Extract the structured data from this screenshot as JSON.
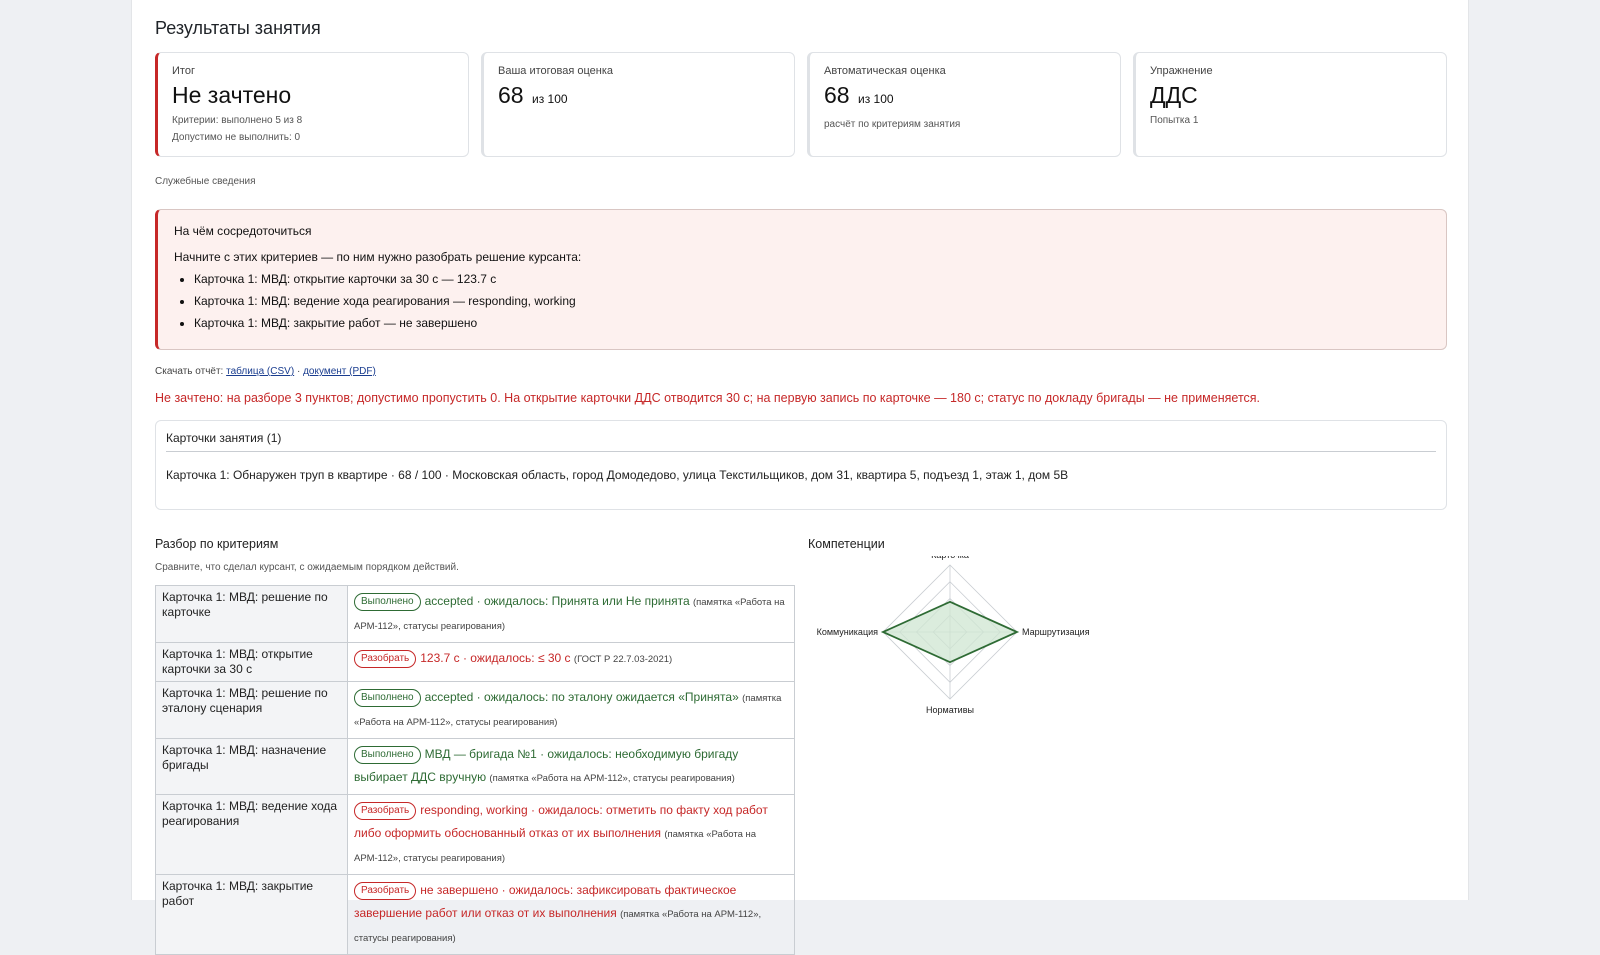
{
  "page_title": "Результаты занятия",
  "summary": {
    "result": {
      "label": "Итог",
      "value": "Не зачтено",
      "criteria": "Критерии: выполнено 5 из 8",
      "allowed": "Допустимо не выполнить: 0"
    },
    "final_score": {
      "label": "Ваша итоговая оценка",
      "value": "68",
      "of": "из 100"
    },
    "auto_score": {
      "label": "Автоматическая оценка",
      "value": "68",
      "of": "из 100",
      "note": "расчёт по критериям занятия"
    },
    "exercise": {
      "label": "Упражнение",
      "value": "ДДС",
      "attempt": "Попытка 1"
    }
  },
  "service_info": "Служебные сведения",
  "focus": {
    "title": "На чём сосредоточиться",
    "intro": "Начните с этих критериев — по ним нужно разобрать решение курсанта:",
    "items": [
      "Карточка 1: МВД: открытие карточки за 30 с — 123.7 с",
      "Карточка 1: МВД: ведение хода реагирования — responding, working",
      "Карточка 1: МВД: закрытие работ — не завершено"
    ]
  },
  "download": {
    "label": "Скачать отчёт:",
    "csv": "таблица (CSV)",
    "sep": "·",
    "pdf": "документ (PDF)"
  },
  "verdict": "Не зачтено: на разборе 3 пунктов; допустимо пропустить 0. На открытие карточки ДДС отводится 30 с; на первую запись по карточке — 180 с; статус по докладу бригады — не применяется.",
  "session_cards": {
    "header": "Карточки занятия (1)",
    "items": [
      "Карточка 1: Обнаружен труп в квартире · 68 / 100 · Московская область, город Домодедово, улица Текстильщиков, дом 31, квартира 5, подъезд 1, этаж 1, дом 5В"
    ]
  },
  "criteria_section": {
    "title": "Разбор по критериям",
    "subtitle": "Сравните, что сделал курсант, с ожидаемым порядком действий.",
    "rows": [
      {
        "name": "Карточка 1: МВД: решение по карточке",
        "status": "Выполнено",
        "kind": "ok",
        "text": "accepted · ожидалось: Принята или Не принята",
        "note": "(памятка «Работа на АРМ-112», статусы реагирования)"
      },
      {
        "name": "Карточка 1: МВД: открытие карточки за 30 с",
        "status": "Разобрать",
        "kind": "bad",
        "text": "123.7 с · ожидалось: ≤ 30 с",
        "note": "(ГОСТ Р 22.7.03-2021)"
      },
      {
        "name": "Карточка 1: МВД: решение по эталону сценария",
        "status": "Выполнено",
        "kind": "ok",
        "text": "accepted · ожидалось: по эталону ожидается «Принята»",
        "note": "(памятка «Работа на АРМ-112», статусы реагирования)"
      },
      {
        "name": "Карточка 1: МВД: назначение бригады",
        "status": "Выполнено",
        "kind": "ok",
        "text": "МВД — бригада №1 · ожидалось: необходимую бригаду выбирает ДДС вручную",
        "note": "(памятка «Работа на АРМ-112», статусы реагирования)"
      },
      {
        "name": "Карточка 1: МВД: ведение хода реагирования",
        "status": "Разобрать",
        "kind": "bad",
        "text": "responding, working · ожидалось: отметить по факту ход работ либо оформить обоснованный отказ от их выполнения",
        "note": "(памятка «Работа на АРМ-112», статусы реагирования)"
      },
      {
        "name": "Карточка 1: МВД: закрытие работ",
        "status": "Разобрать",
        "kind": "bad",
        "text": "не завершено · ожидалось: зафиксировать фактическое завершение работ или отказ от их выполнения",
        "note": "(памятка «Работа на АРМ-112», статусы реагирования)"
      }
    ]
  },
  "competencies": {
    "title": "Компетенции",
    "axes": [
      "Карточка",
      "Маршрутизация",
      "Нормативы",
      "Коммуникация"
    ],
    "values": [
      0.45,
      1.0,
      0.45,
      1.0
    ],
    "colors": {
      "fill": "#cfe5d2",
      "stroke": "#2e6b34",
      "grid": "#c9cdd2"
    }
  }
}
